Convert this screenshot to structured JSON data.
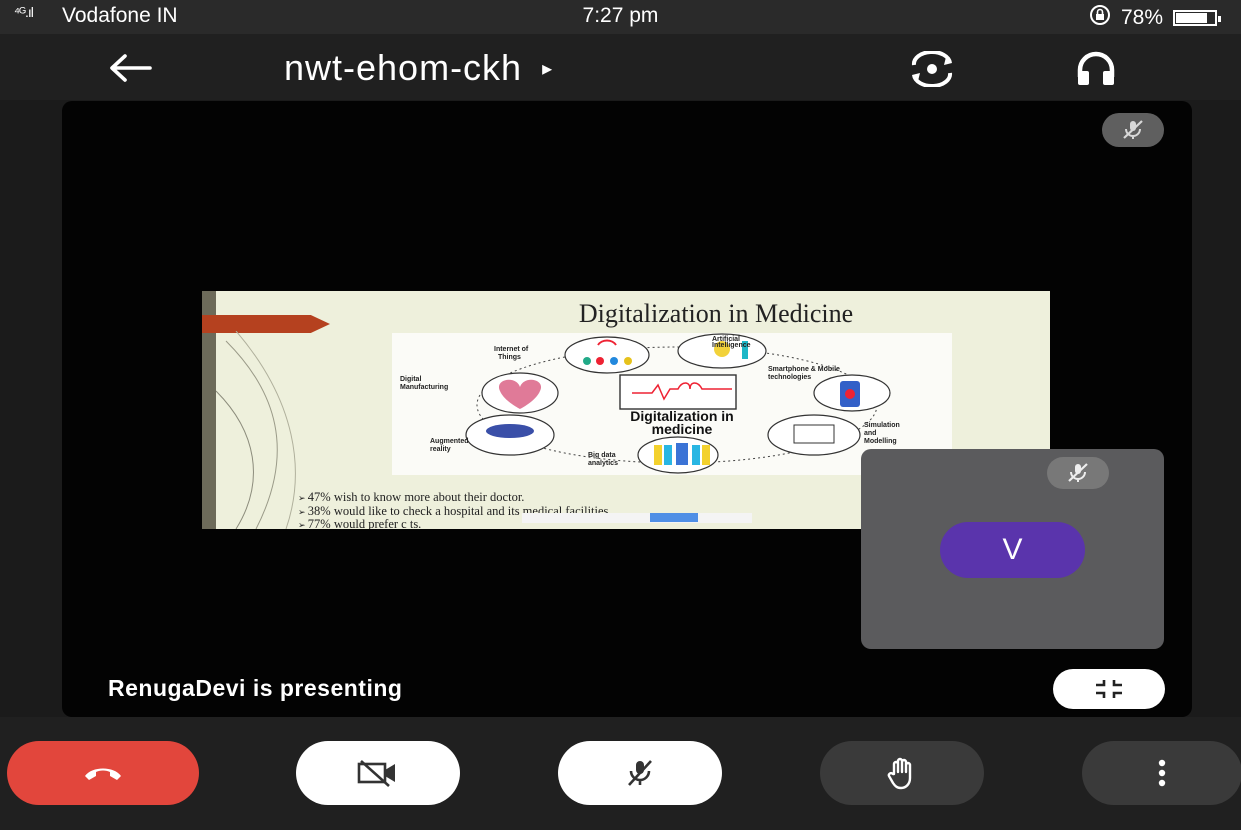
{
  "status_bar": {
    "signal": "⁴ᴳ.ıl",
    "carrier": "Vodafone IN",
    "time": "7:27 pm",
    "battery_percent": "78%",
    "battery_level": 0.78
  },
  "header": {
    "meeting_code": "nwt-ehom-ckh",
    "caret": "▸",
    "icons": [
      "back-arrow-icon",
      "switch-camera-icon",
      "headphones-icon"
    ]
  },
  "slide": {
    "title": "Digitalization in Medicine",
    "center_label_line1": "Digitalization in",
    "center_label_line2": "medicine",
    "nodes": [
      "Internet of Things",
      "Artificial Intelligence",
      "Smartphone & Mobile technologies",
      "Digital Manufacturing",
      "Simulation and Modelling",
      "Augmented reality",
      "Big data analytics"
    ],
    "bullets": [
      "47% wish to know more about their doctor.",
      "38% would like to check a hospital and its medical facilities",
      "77% would prefer c                                                     ts."
    ]
  },
  "stage": {
    "presenting_text": "RenugaDevi is presenting"
  },
  "self_view": {
    "avatar_letter": "V",
    "avatar_color": "#5a34ac"
  },
  "controls": {
    "end_call_color": "#e2463c",
    "icons": [
      "hang-up-icon",
      "camera-off-icon",
      "mic-off-icon",
      "raise-hand-icon",
      "more-vert-icon"
    ]
  }
}
